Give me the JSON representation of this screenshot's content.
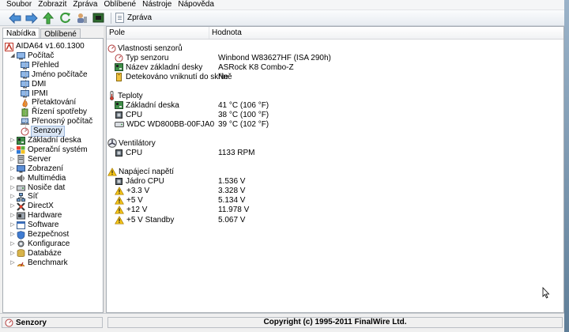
{
  "menu": [
    "Soubor",
    "Zobrazit",
    "Zpráva",
    "Oblíbené",
    "Nástroje",
    "Nápověda"
  ],
  "toolbar": {
    "buttons": [
      "back-arrow-icon",
      "forward-arrow-icon",
      "up-arrow-icon",
      "refresh-icon",
      "user-icon",
      "chip-icon"
    ],
    "report_label": "Zpráva"
  },
  "left_tabs": [
    "Nabídka",
    "Oblíbené"
  ],
  "tree": [
    {
      "label": "AIDA64 v1.60.1300",
      "icon": "aida64-icon",
      "depth": 0,
      "exp": ""
    },
    {
      "label": "Počítač",
      "icon": "computer-icon",
      "depth": 1,
      "exp": "▲"
    },
    {
      "label": "Přehled",
      "icon": "computer-icon",
      "depth": 2,
      "exp": ""
    },
    {
      "label": "Jméno počítače",
      "icon": "computer-icon",
      "depth": 2,
      "exp": ""
    },
    {
      "label": "DMI",
      "icon": "computer-icon",
      "depth": 2,
      "exp": ""
    },
    {
      "label": "IPMI",
      "icon": "computer-icon",
      "depth": 2,
      "exp": ""
    },
    {
      "label": "Přetaktování",
      "icon": "flame-icon",
      "depth": 2,
      "exp": ""
    },
    {
      "label": "Řízení spotřeby",
      "icon": "power-icon",
      "depth": 2,
      "exp": ""
    },
    {
      "label": "Přenosný počítač",
      "icon": "laptop-icon",
      "depth": 2,
      "exp": ""
    },
    {
      "label": "Senzory",
      "icon": "sensor-icon",
      "depth": 2,
      "exp": "",
      "selected": true
    },
    {
      "label": "Základní deska",
      "icon": "motherboard-icon",
      "depth": 1,
      "exp": "▷"
    },
    {
      "label": "Operační systém",
      "icon": "windows-icon",
      "depth": 1,
      "exp": "▷"
    },
    {
      "label": "Server",
      "icon": "server-icon",
      "depth": 1,
      "exp": "▷"
    },
    {
      "label": "Zobrazení",
      "icon": "display-icon",
      "depth": 1,
      "exp": "▷"
    },
    {
      "label": "Multimédia",
      "icon": "multimedia-icon",
      "depth": 1,
      "exp": "▷"
    },
    {
      "label": "Nosiče dat",
      "icon": "storage-icon",
      "depth": 1,
      "exp": "▷"
    },
    {
      "label": "Síť",
      "icon": "network-icon",
      "depth": 1,
      "exp": "▷"
    },
    {
      "label": "DirectX",
      "icon": "directx-icon",
      "depth": 1,
      "exp": "▷"
    },
    {
      "label": "Hardware",
      "icon": "hardware-icon",
      "depth": 1,
      "exp": "▷"
    },
    {
      "label": "Software",
      "icon": "software-icon",
      "depth": 1,
      "exp": "▷"
    },
    {
      "label": "Bezpečnost",
      "icon": "security-icon",
      "depth": 1,
      "exp": "▷"
    },
    {
      "label": "Konfigurace",
      "icon": "config-icon",
      "depth": 1,
      "exp": "▷"
    },
    {
      "label": "Databáze",
      "icon": "database-icon",
      "depth": 1,
      "exp": "▷"
    },
    {
      "label": "Benchmark",
      "icon": "benchmark-icon",
      "depth": 1,
      "exp": "▷"
    }
  ],
  "columns": [
    "Pole",
    "Hodnota"
  ],
  "groups": [
    {
      "title": "Vlastnosti senzorů",
      "icon": "sensor-icon",
      "rows": [
        {
          "field": "Typ senzoru",
          "value": "Winbond W83627HF  (ISA 290h)",
          "icon": "sensor-icon"
        },
        {
          "field": "Název základní desky",
          "value": "ASRock K8 Combo-Z",
          "icon": "motherboard-icon"
        },
        {
          "field": "Detekováno vniknutí do skříně",
          "value": "Ne",
          "icon": "case-icon"
        }
      ]
    },
    {
      "title": "Teploty",
      "icon": "thermometer-icon",
      "rows": [
        {
          "field": "Základní deska",
          "value": "41 °C  (106 °F)",
          "icon": "motherboard-icon"
        },
        {
          "field": "CPU",
          "value": "38 °C  (100 °F)",
          "icon": "cpu-icon"
        },
        {
          "field": "WDC WD800BB-00FJA0",
          "value": "39 °C  (102 °F)",
          "icon": "hdd-icon"
        }
      ]
    },
    {
      "title": "Ventilátory",
      "icon": "fan-icon",
      "rows": [
        {
          "field": "CPU",
          "value": "1133 RPM",
          "icon": "cpu-icon"
        }
      ]
    },
    {
      "title": "Napájecí napětí",
      "icon": "warning-icon",
      "rows": [
        {
          "field": "Jádro CPU",
          "value": "1.536 V",
          "icon": "cpu-icon"
        },
        {
          "field": "+3.3 V",
          "value": "3.328 V",
          "icon": "warning-icon"
        },
        {
          "field": "+5 V",
          "value": "5.134 V",
          "icon": "warning-icon"
        },
        {
          "field": "+12 V",
          "value": "11.978 V",
          "icon": "warning-icon"
        },
        {
          "field": "+5 V Standby",
          "value": "5.067 V",
          "icon": "warning-icon"
        }
      ]
    }
  ],
  "status": {
    "left": "Senzory",
    "copyright": "Copyright (c) 1995-2011 FinalWire Ltd."
  }
}
